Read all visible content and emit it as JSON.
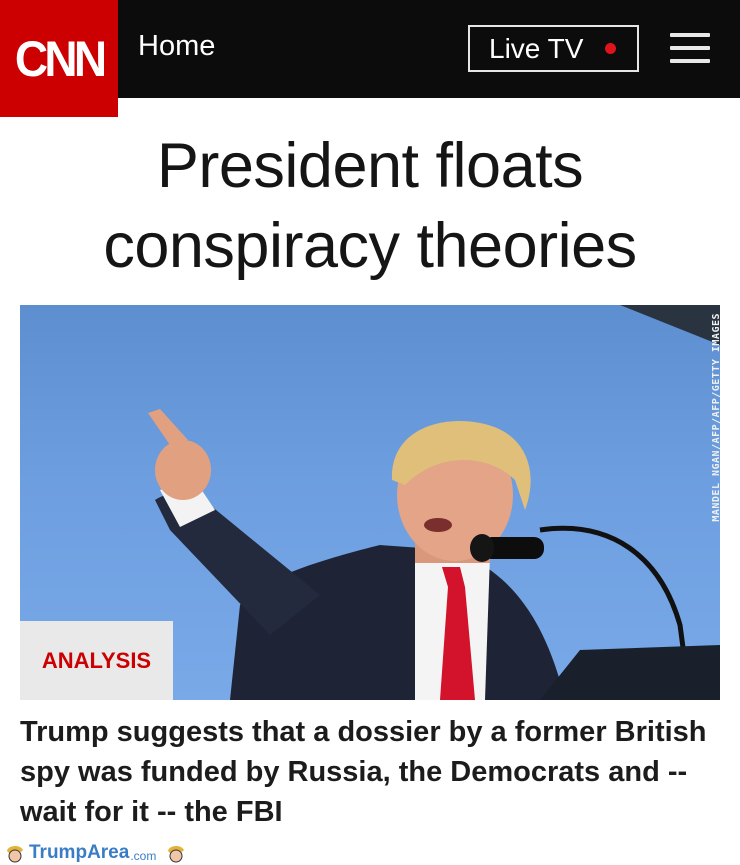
{
  "header": {
    "logo_text": "CNN",
    "home_label": "Home",
    "live_label": "Live TV",
    "live_dot_color": "#e0131b",
    "menu_icon": "hamburger-menu-icon"
  },
  "article": {
    "headline": "President floats conspiracy theories",
    "image_credit": "MANDEL NGAN/AFP/AFP/GETTY IMAGES",
    "badge": "ANALYSIS",
    "subheadline": "Trump suggests that a dossier by a former British spy was funded by Russia, the Democrats and -- wait for it -- the FBI"
  },
  "watermark": {
    "part1": "Trump",
    "part2": "Area",
    "part3": ".com"
  },
  "colors": {
    "brand_red": "#cc0000",
    "topbar": "#0c0c0c",
    "watermark_blue": "#3a7dc6"
  }
}
